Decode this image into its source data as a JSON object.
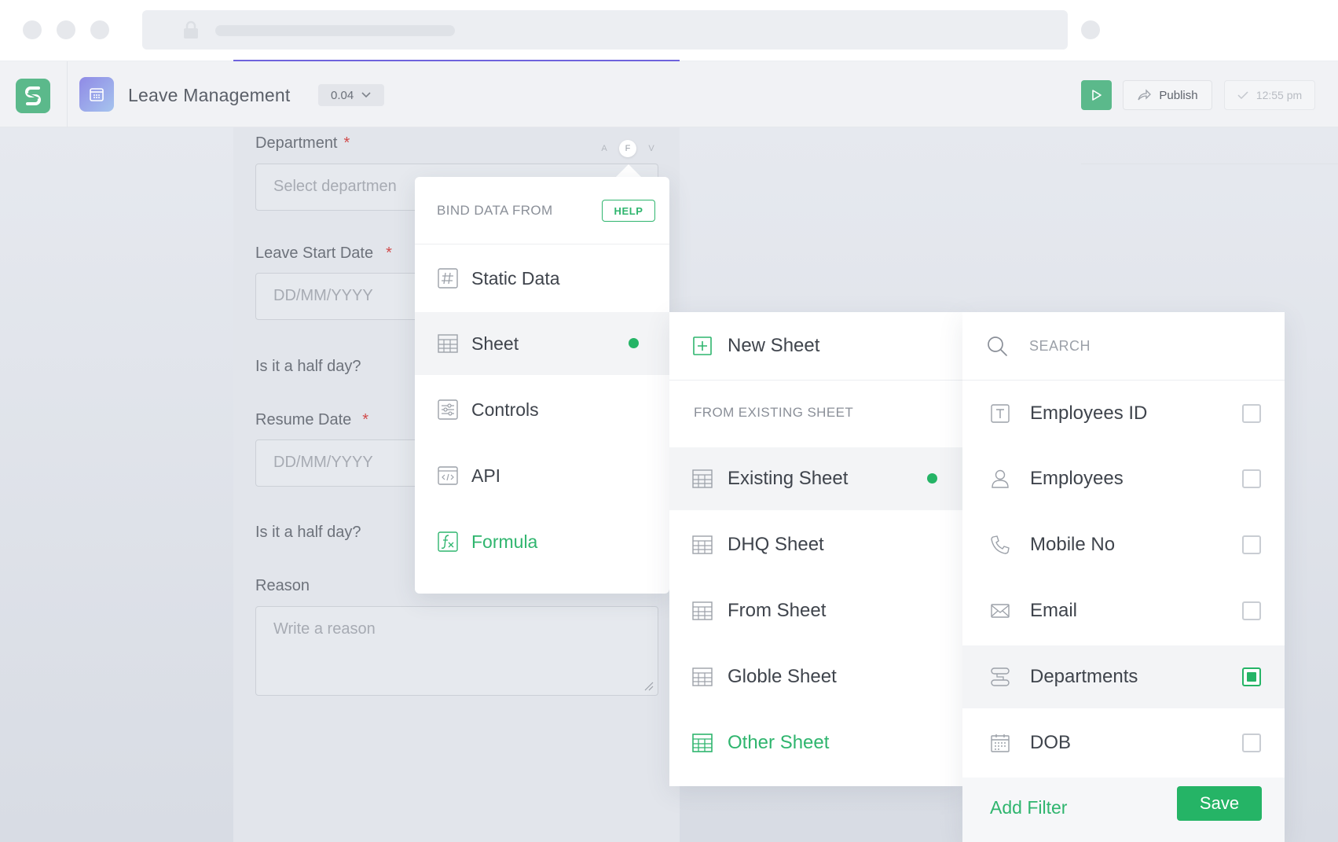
{
  "app": {
    "title": "Leave Management",
    "version": "0.04",
    "publish_label": "Publish",
    "saved_time": "12:55 pm"
  },
  "form": {
    "department_label": "Department",
    "department_placeholder": "Select departmen",
    "leave_start_label": "Leave Start Date",
    "leave_start_placeholder": "DD/MM/YYYY",
    "half_day_label_1": "Is it a half day?",
    "resume_label": "Resume Date",
    "resume_placeholder": "DD/MM/YYYY",
    "half_day_label_2": "Is it a half day?",
    "reason_label": "Reason",
    "reason_placeholder": "Write a reason",
    "required_mark": "*",
    "mode_tabs": [
      "A",
      "F",
      "V"
    ]
  },
  "bind_menu": {
    "header": "BIND DATA FROM",
    "help_label": "HELP",
    "items": [
      {
        "label": "Static Data",
        "icon": "hash-icon"
      },
      {
        "label": "Sheet",
        "icon": "table-icon",
        "selected": true
      },
      {
        "label": "Controls",
        "icon": "sliders-icon"
      },
      {
        "label": "API",
        "icon": "code-window-icon"
      },
      {
        "label": "Formula",
        "icon": "formula-icon",
        "accent": true
      }
    ]
  },
  "sheet_menu": {
    "new_sheet_label": "New Sheet",
    "section_label": "FROM EXISTING SHEET",
    "items": [
      {
        "label": "Existing Sheet",
        "selected": true
      },
      {
        "label": "DHQ Sheet"
      },
      {
        "label": "From Sheet"
      },
      {
        "label": "Globle Sheet"
      },
      {
        "label": "Other Sheet",
        "accent": true
      }
    ]
  },
  "fields_menu": {
    "search_placeholder": "SEARCH",
    "items": [
      {
        "label": "Employees ID",
        "icon": "text-field-icon",
        "checked": false
      },
      {
        "label": "Employees",
        "icon": "user-icon",
        "checked": false
      },
      {
        "label": "Mobile No",
        "icon": "phone-icon",
        "checked": false
      },
      {
        "label": "Email",
        "icon": "mail-icon",
        "checked": false
      },
      {
        "label": "Departments",
        "icon": "departments-icon",
        "checked": true
      },
      {
        "label": "DOB",
        "icon": "calendar-icon",
        "checked": false
      }
    ],
    "add_filter_label": "Add Filter",
    "save_label": "Save"
  },
  "colors": {
    "accent_green": "#25b466",
    "brand_green": "#5bb98b",
    "progress_purple": "#6f63dd"
  }
}
